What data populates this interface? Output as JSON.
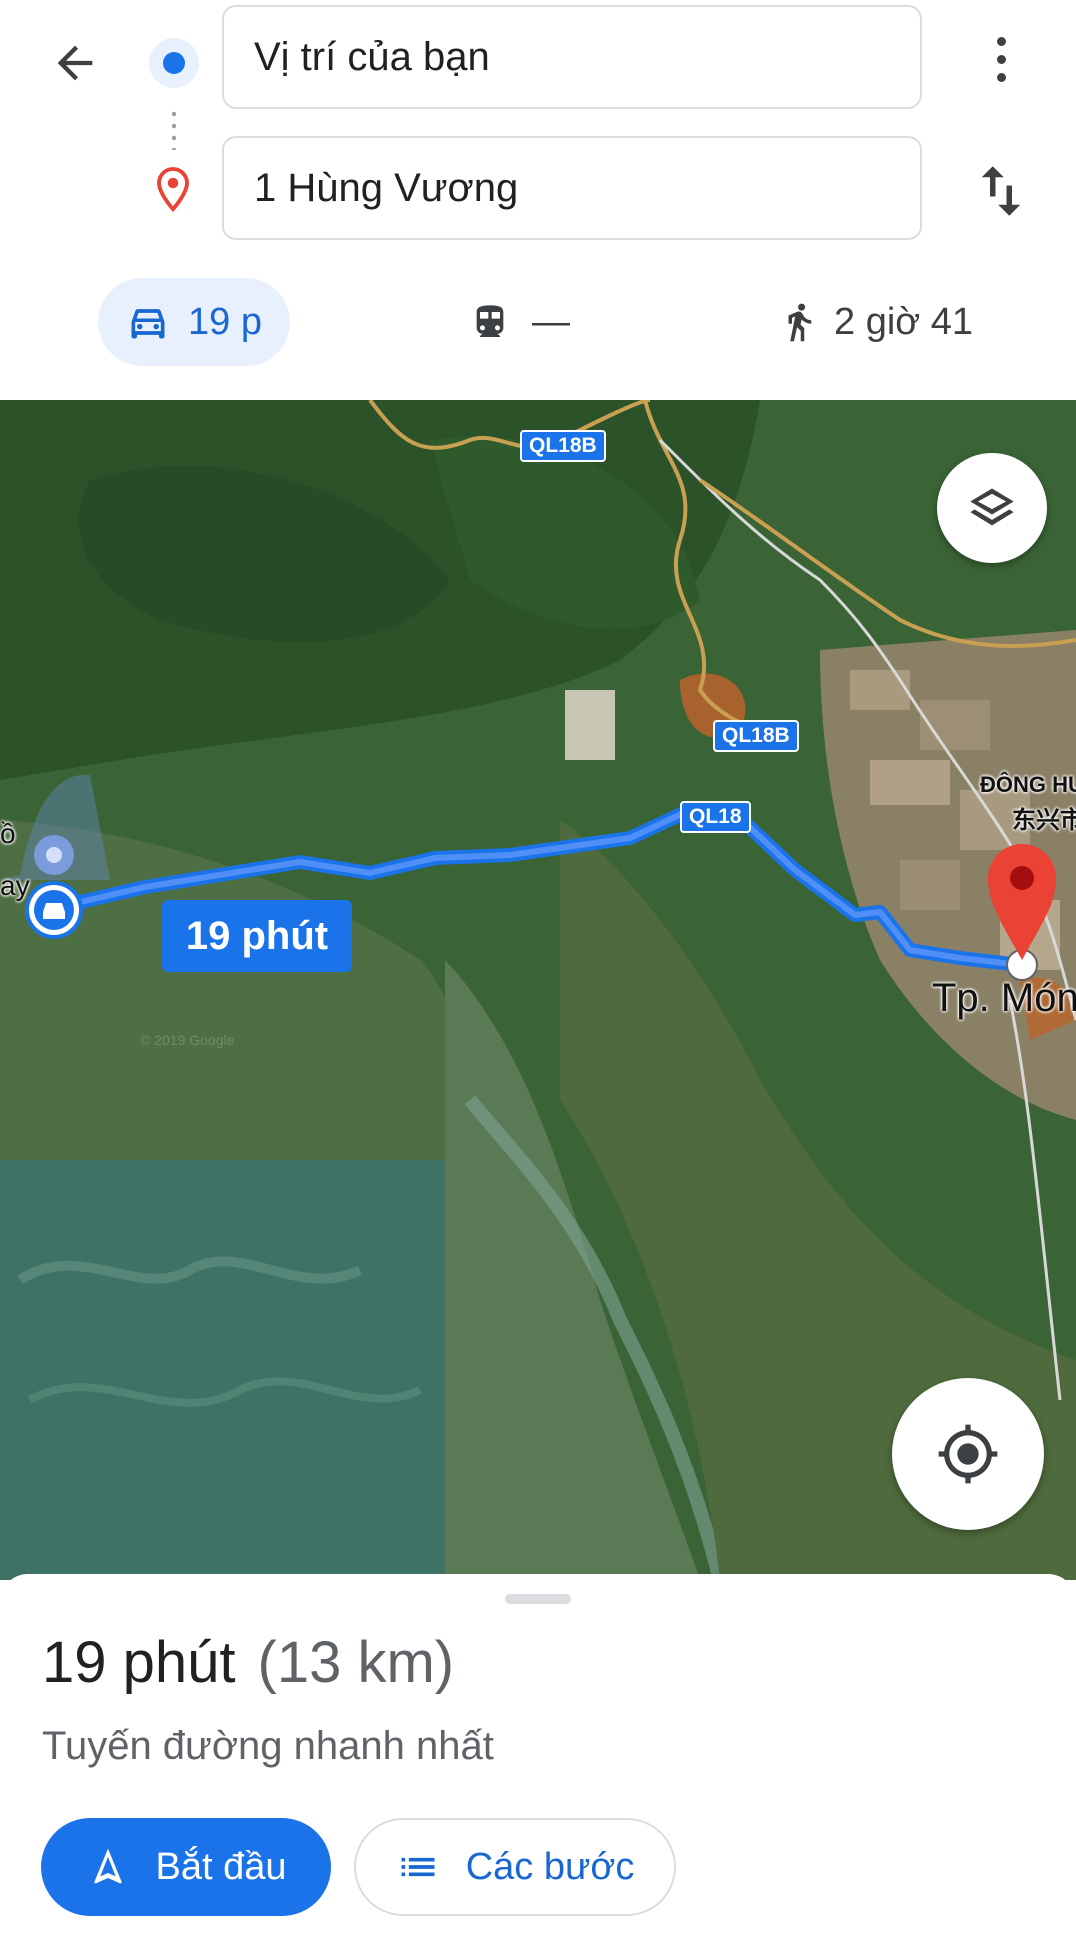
{
  "search": {
    "origin_value": "Vị trí của bạn",
    "destination_value": "1 Hùng Vương"
  },
  "modes": {
    "car": {
      "label": "19 p",
      "icon": "car-icon"
    },
    "transit": {
      "label": "—",
      "icon": "train-icon"
    },
    "walk": {
      "label": "2 giờ 41",
      "icon": "walk-icon"
    }
  },
  "map": {
    "route_duration_label": "19 phút",
    "road_labels": [
      "QL18B",
      "QL18B",
      "QL18"
    ],
    "place_labels": [
      "ĐÔNG HƯ",
      "东兴市",
      "Tp. Móng",
      "ồ",
      "ay"
    ],
    "watermark": "© 2019 Google",
    "colors": {
      "route": "#1a73e8",
      "destination_pin": "#ea4335"
    }
  },
  "sheet": {
    "duration": "19 phút",
    "distance": "(13 km)",
    "subtitle": "Tuyến đường nhanh nhất",
    "start_label": "Bắt đầu",
    "steps_label": "Các bước"
  }
}
